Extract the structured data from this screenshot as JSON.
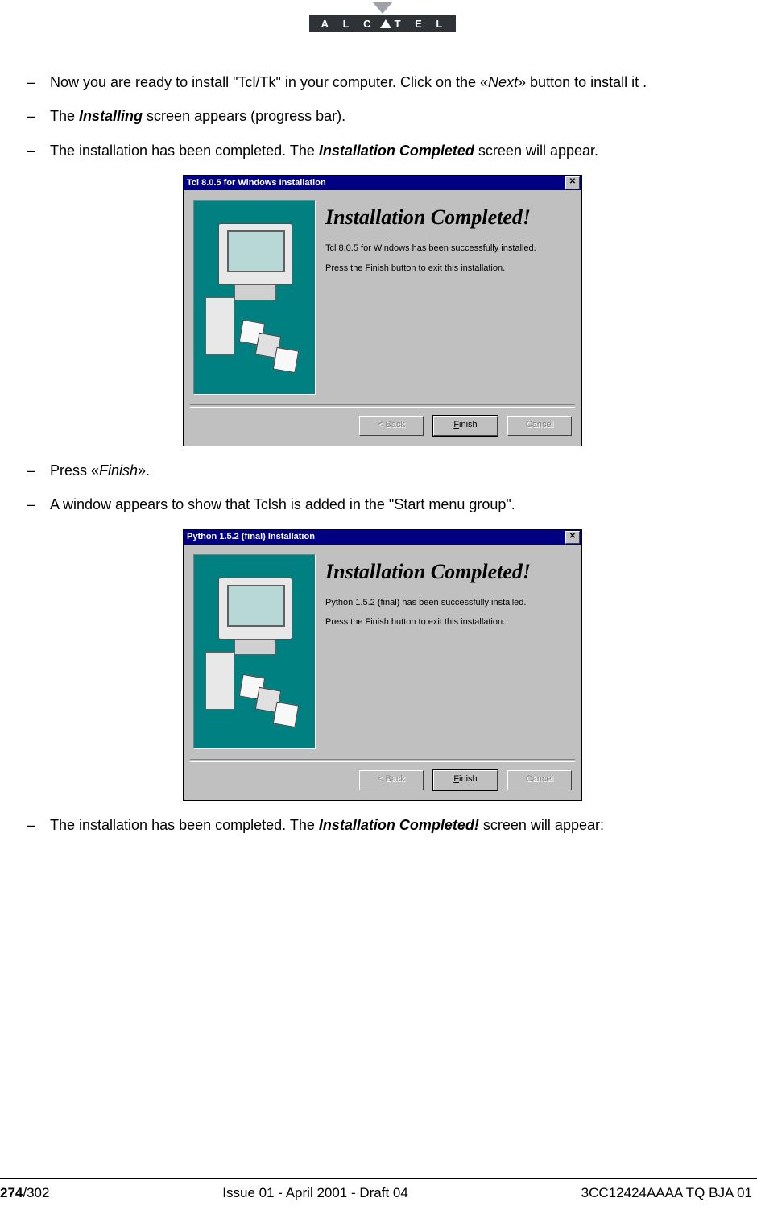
{
  "logo_text": "A L C T E L",
  "bullets": {
    "b1a": "Now you are ready to install \"Tcl/Tk\" in your computer. Click on the «",
    "b1i": "Next",
    "b1b": "» button to install it .",
    "b2a": "The ",
    "b2bi": "Installing",
    "b2b": " screen appears (progress bar).",
    "b3a": "The installation has been completed. The ",
    "b3bi": "Installation Completed",
    "b3b": " screen will appear.",
    "b4a": "Press «",
    "b4i": "Finish",
    "b4b": "».",
    "b5": "A window appears to show that Tclsh is added in the \"Start menu group\".",
    "b6a": "The installation has been completed. The ",
    "b6bi": "Installation Completed!",
    "b6b": " screen will appear:"
  },
  "dialog1": {
    "title": "Tcl 8.0.5 for Windows Installation",
    "heading": "Installation Completed!",
    "line1": "Tcl 8.0.5 for Windows has been successfully installed.",
    "line2": "Press the Finish button to exit this installation.",
    "btn_back": "< Back",
    "btn_finish_pre": "",
    "btn_finish_u": "F",
    "btn_finish_post": "inish",
    "btn_cancel": "Cancel"
  },
  "dialog2": {
    "title": "Python 1.5.2 (final) Installation",
    "heading": "Installation Completed!",
    "line1": "Python 1.5.2 (final) has been successfully installed.",
    "line2": "Press the Finish button to exit this installation.",
    "btn_back": "< Back",
    "btn_finish_u": "F",
    "btn_finish_post": "inish",
    "btn_cancel": "Cancel"
  },
  "footer": {
    "page_bold": "274",
    "page_rest": "/302",
    "center": "Issue 01 - April 2001 - Draft 04",
    "right": "3CC12424AAAA TQ BJA 01"
  }
}
